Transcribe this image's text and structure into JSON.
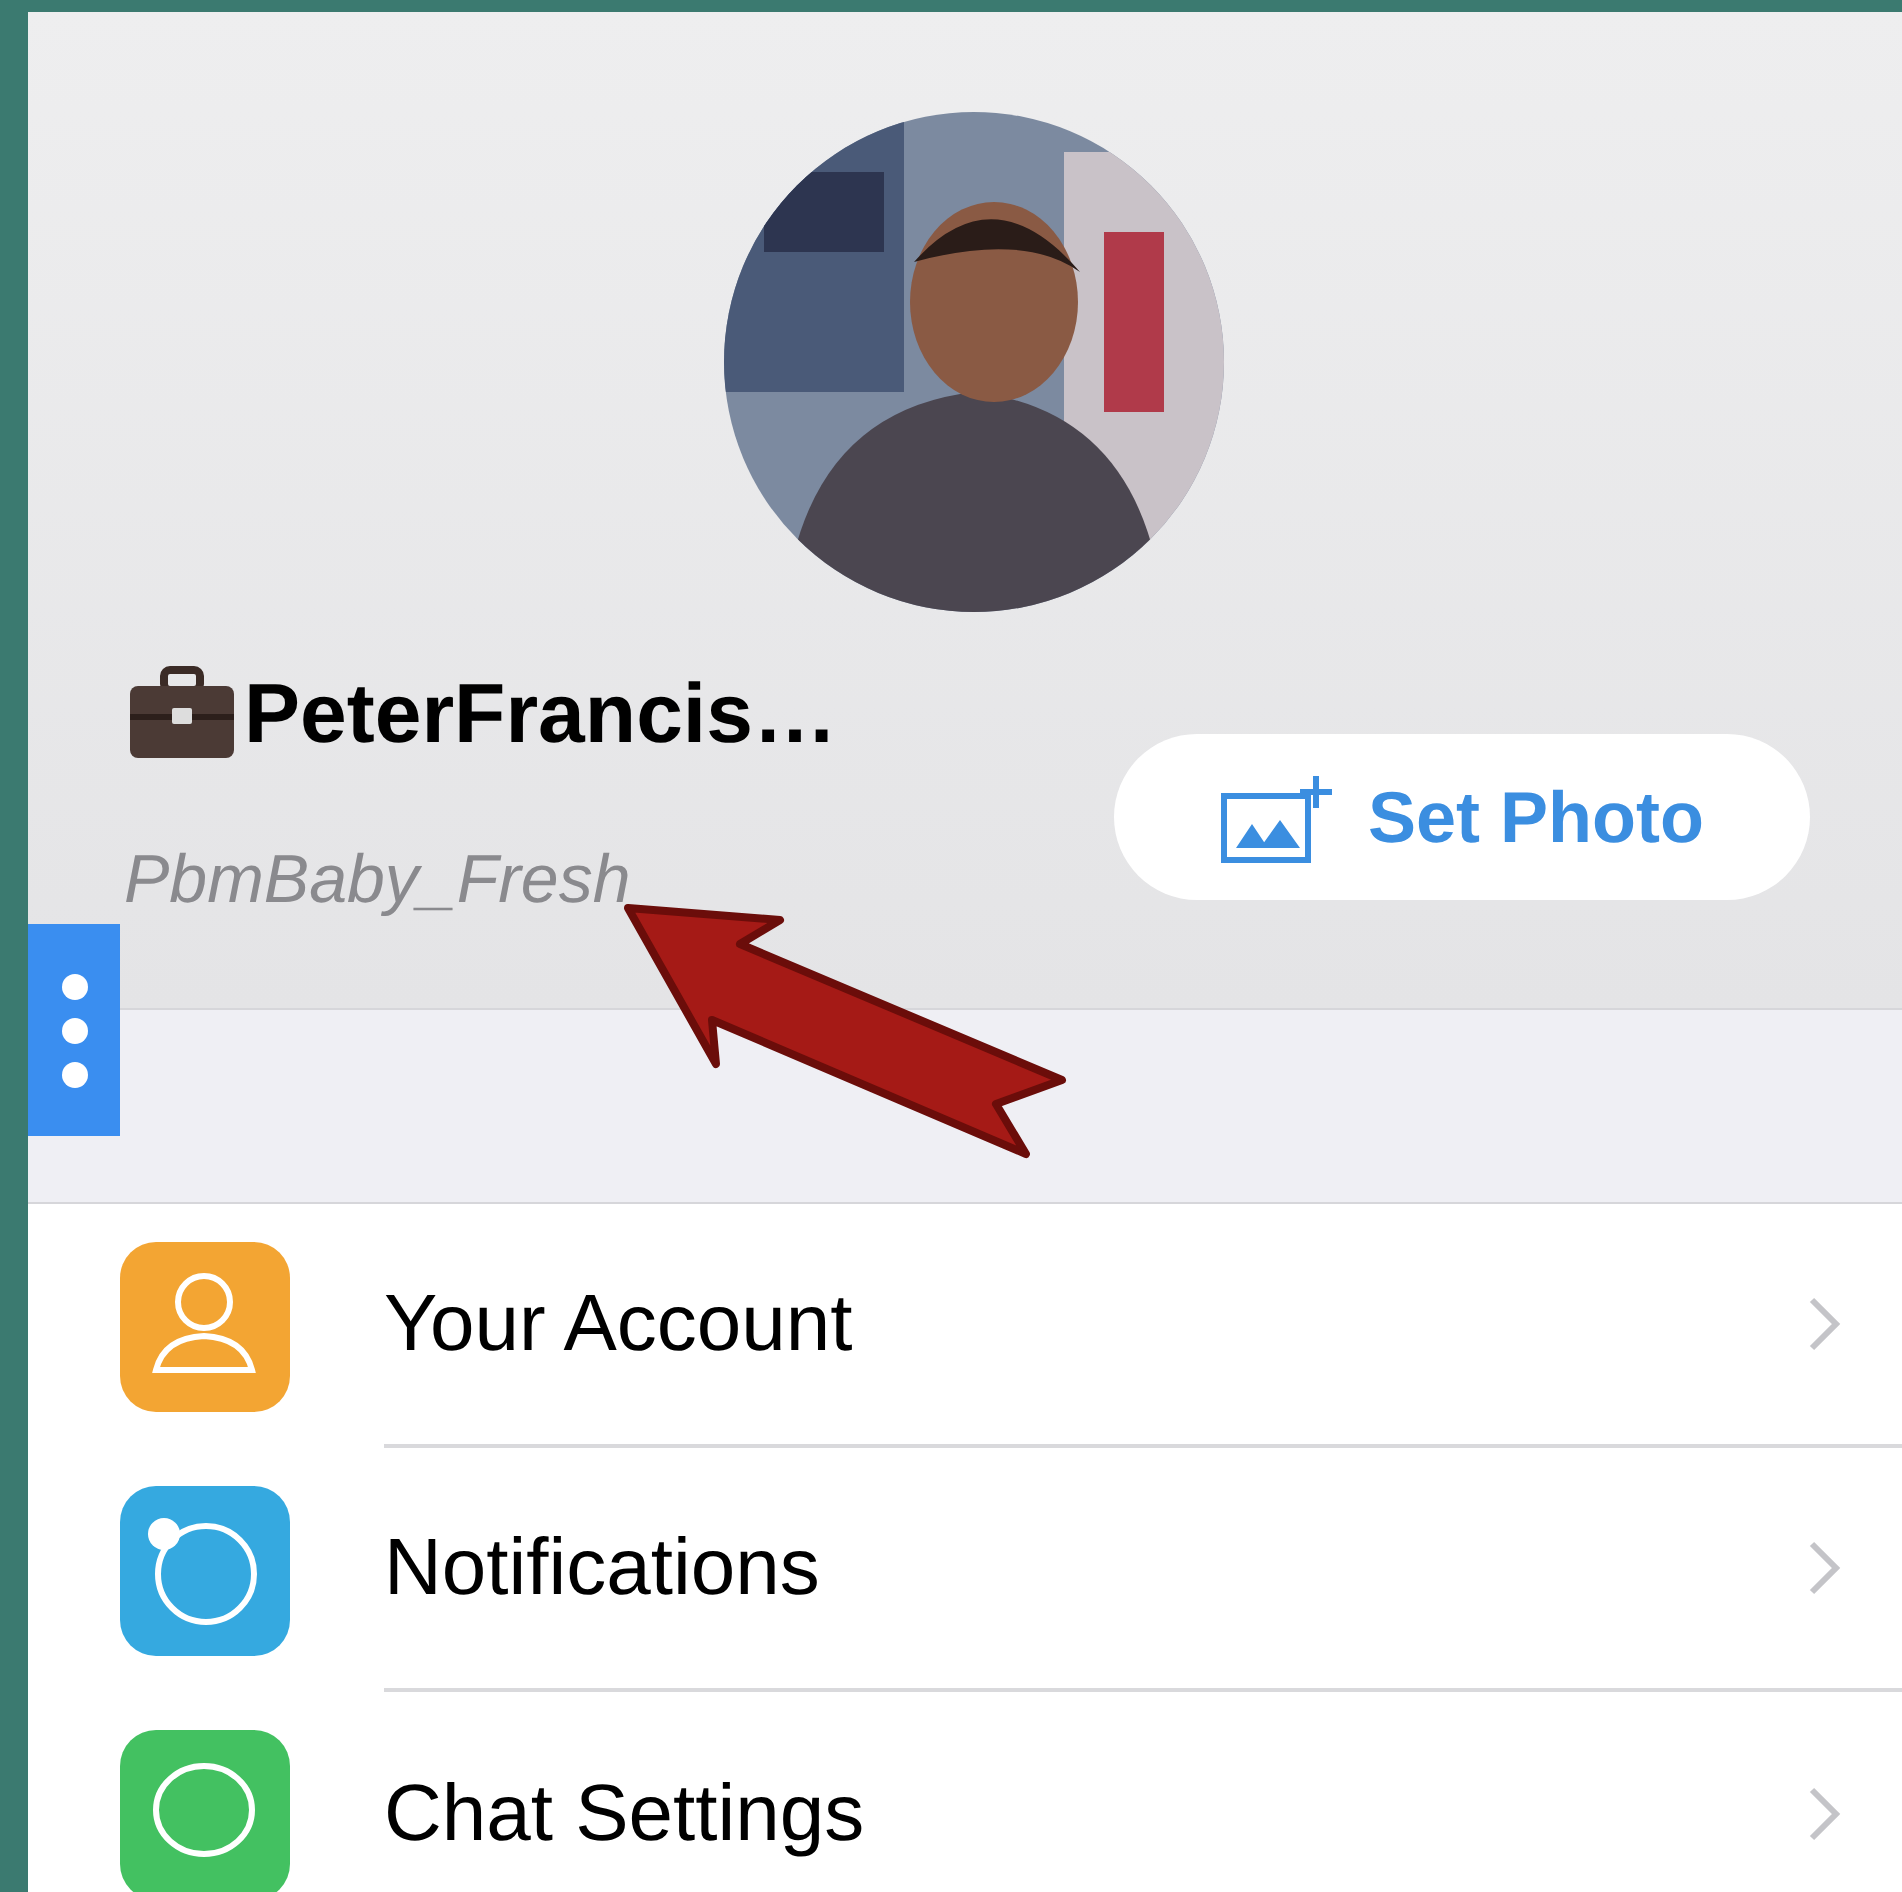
{
  "profile": {
    "name": "PeterFrancis…",
    "username": "PbmBaby_Fresh",
    "set_photo_button": "Set Photo"
  },
  "menu_items": [
    {
      "label": "Your Account",
      "kind": "person",
      "color": "#f3a533"
    },
    {
      "label": "Notifications",
      "kind": "ring",
      "color": "#35a9e0"
    },
    {
      "label": "Chat Settings",
      "kind": "bubble",
      "color": "#43c161"
    }
  ]
}
